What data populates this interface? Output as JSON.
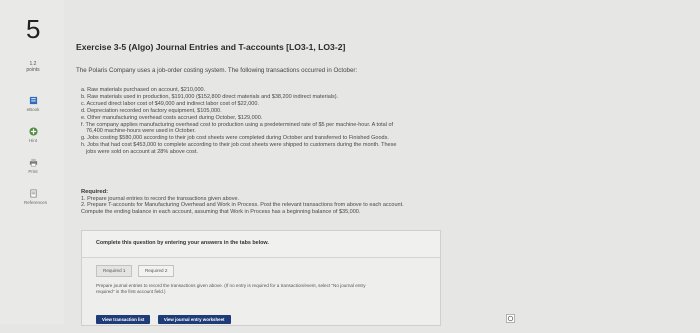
{
  "question": {
    "number": "5",
    "points_value": "1.2",
    "points_label": "points"
  },
  "sidebar": {
    "tools": [
      {
        "label": "eBook",
        "icon": "book-icon"
      },
      {
        "label": "Hint",
        "icon": "hint-icon"
      },
      {
        "label": "Print",
        "icon": "print-icon"
      },
      {
        "label": "References",
        "icon": "references-icon"
      }
    ]
  },
  "exercise": {
    "title": "Exercise 3-5 (Algo) Journal Entries and T-accounts [LO3-1, LO3-2]",
    "intro": "The Polaris Company uses a job-order costing system. The following transactions occurred in October:",
    "transactions": [
      "a. Raw materials purchased on account, $210,000.",
      "b. Raw materials used in production, $191,000 ($152,800 direct materials and $38,200 indirect materials).",
      "c. Accrued direct labor cost of $49,000 and indirect labor cost of $22,000.",
      "d. Depreciation recorded on factory equipment, $105,000.",
      "e. Other manufacturing overhead costs accrued during October, $129,000.",
      "f. The company applies manufacturing overhead cost to production using a predetermined rate of $5 per machine-hour. A total of",
      "76,400 machine-hours were used in October.",
      "g. Jobs costing $580,000 according to their job cost sheets were completed during October and transferred to Finished Goods.",
      "h. Jobs that had cost $453,000 to complete according to their job cost sheets were shipped to customers during the month. These",
      "jobs were sold on account at 28% above cost."
    ],
    "required_heading": "Required:",
    "required": [
      "1. Prepare journal entries to record the transactions given above.",
      "2. Prepare T-accounts for Manufacturing Overhead and Work in Process. Post the relevant transactions from above to each account.",
      "Compute the ending balance in each account, assuming that Work in Process has a beginning balance of $35,000."
    ]
  },
  "answer_panel": {
    "instruction": "Complete this question by entering your answers in the tabs below.",
    "tabs": [
      "Required 1",
      "Required 2"
    ],
    "hint_line1": "Prepare journal entries to record the transactions given above. (If no entry is required for a transaction/event, select \"No journal entry",
    "hint_line2": "required\" in the first account field.)",
    "view_transaction_list": "View transaction list",
    "view_journal_worksheet": "View journal entry worksheet"
  },
  "colors": {
    "accent": "#1e3c78",
    "background": "#e6e6e4",
    "hint_icon": "#4a8a3a",
    "book_icon": "#2e6bbf"
  }
}
